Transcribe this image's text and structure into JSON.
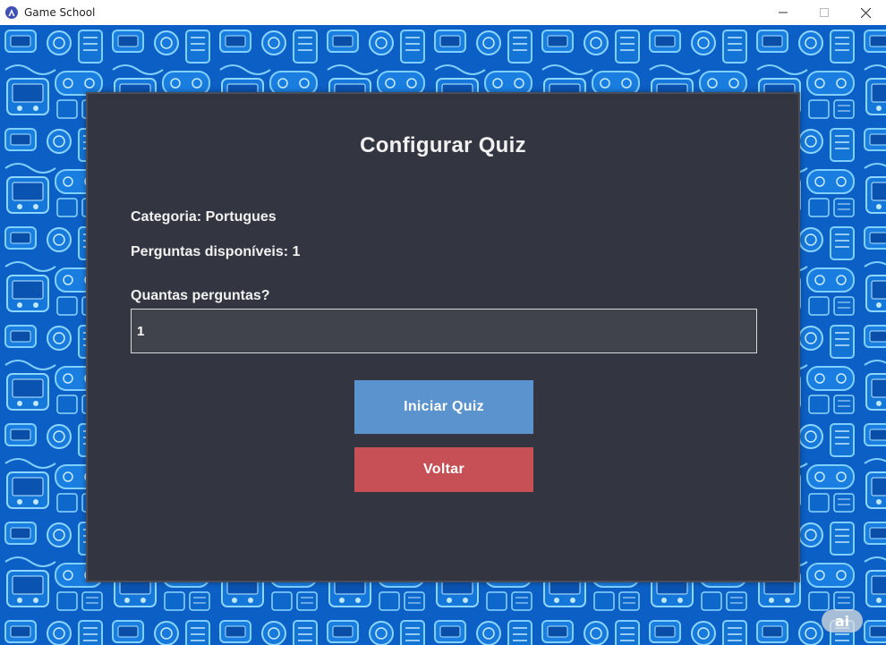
{
  "window": {
    "title": "Game School",
    "controls": [
      "minimize",
      "maximize",
      "close"
    ]
  },
  "colors": {
    "background_pattern": "#0d63c9",
    "panel": "#333640",
    "start_button": "#5b93cf",
    "back_button": "#c65055"
  },
  "quiz_config": {
    "title": "Configurar Quiz",
    "category_text": "Categoria: Portugues",
    "available_text": "Perguntas disponíveis: 1",
    "quantity_label": "Quantas perguntas?",
    "quantity_value": "1",
    "start_label": "Iniciar Quiz",
    "back_label": "Voltar"
  },
  "watermark": "ai"
}
